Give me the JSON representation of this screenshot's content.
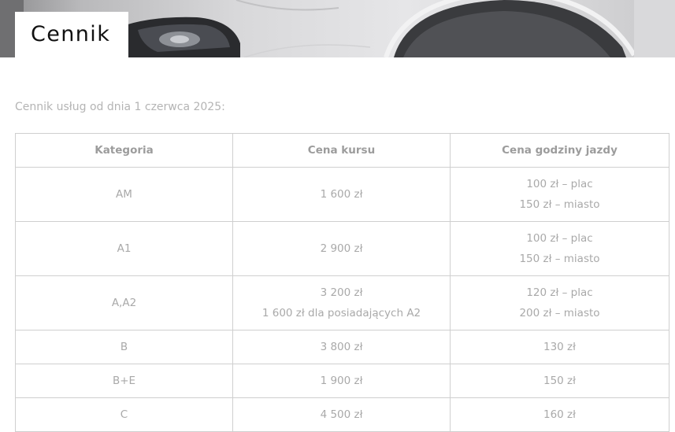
{
  "page": {
    "title": "Cennik",
    "intro": "Cennik usług od dnia 1 czerwca 2025:"
  },
  "hero": {
    "description_icon": "car-image"
  },
  "table": {
    "headers": [
      "Kategoria",
      "Cena kursu",
      "Cena godziny jazdy"
    ],
    "rows": [
      {
        "category": "AM",
        "course": [
          "1 600 zł"
        ],
        "hour": [
          "100 zł – plac",
          "150 zł – miasto"
        ]
      },
      {
        "category": "A1",
        "course": [
          "2 900 zł"
        ],
        "hour": [
          "100 zł – plac",
          "150 zł – miasto"
        ]
      },
      {
        "category": "A,A2",
        "course": [
          "3 200 zł",
          "1 600 zł dla posiadających A2"
        ],
        "hour": [
          "120 zł – plac",
          "200 zł – miasto"
        ]
      },
      {
        "category": "B",
        "course": [
          "3 800 zł"
        ],
        "hour": [
          "130 zł"
        ]
      },
      {
        "category": "B+E",
        "course": [
          "1 900 zł"
        ],
        "hour": [
          "150 zł"
        ]
      },
      {
        "category": "C",
        "course": [
          "4 500 zł"
        ],
        "hour": [
          "160 zł"
        ]
      }
    ]
  }
}
